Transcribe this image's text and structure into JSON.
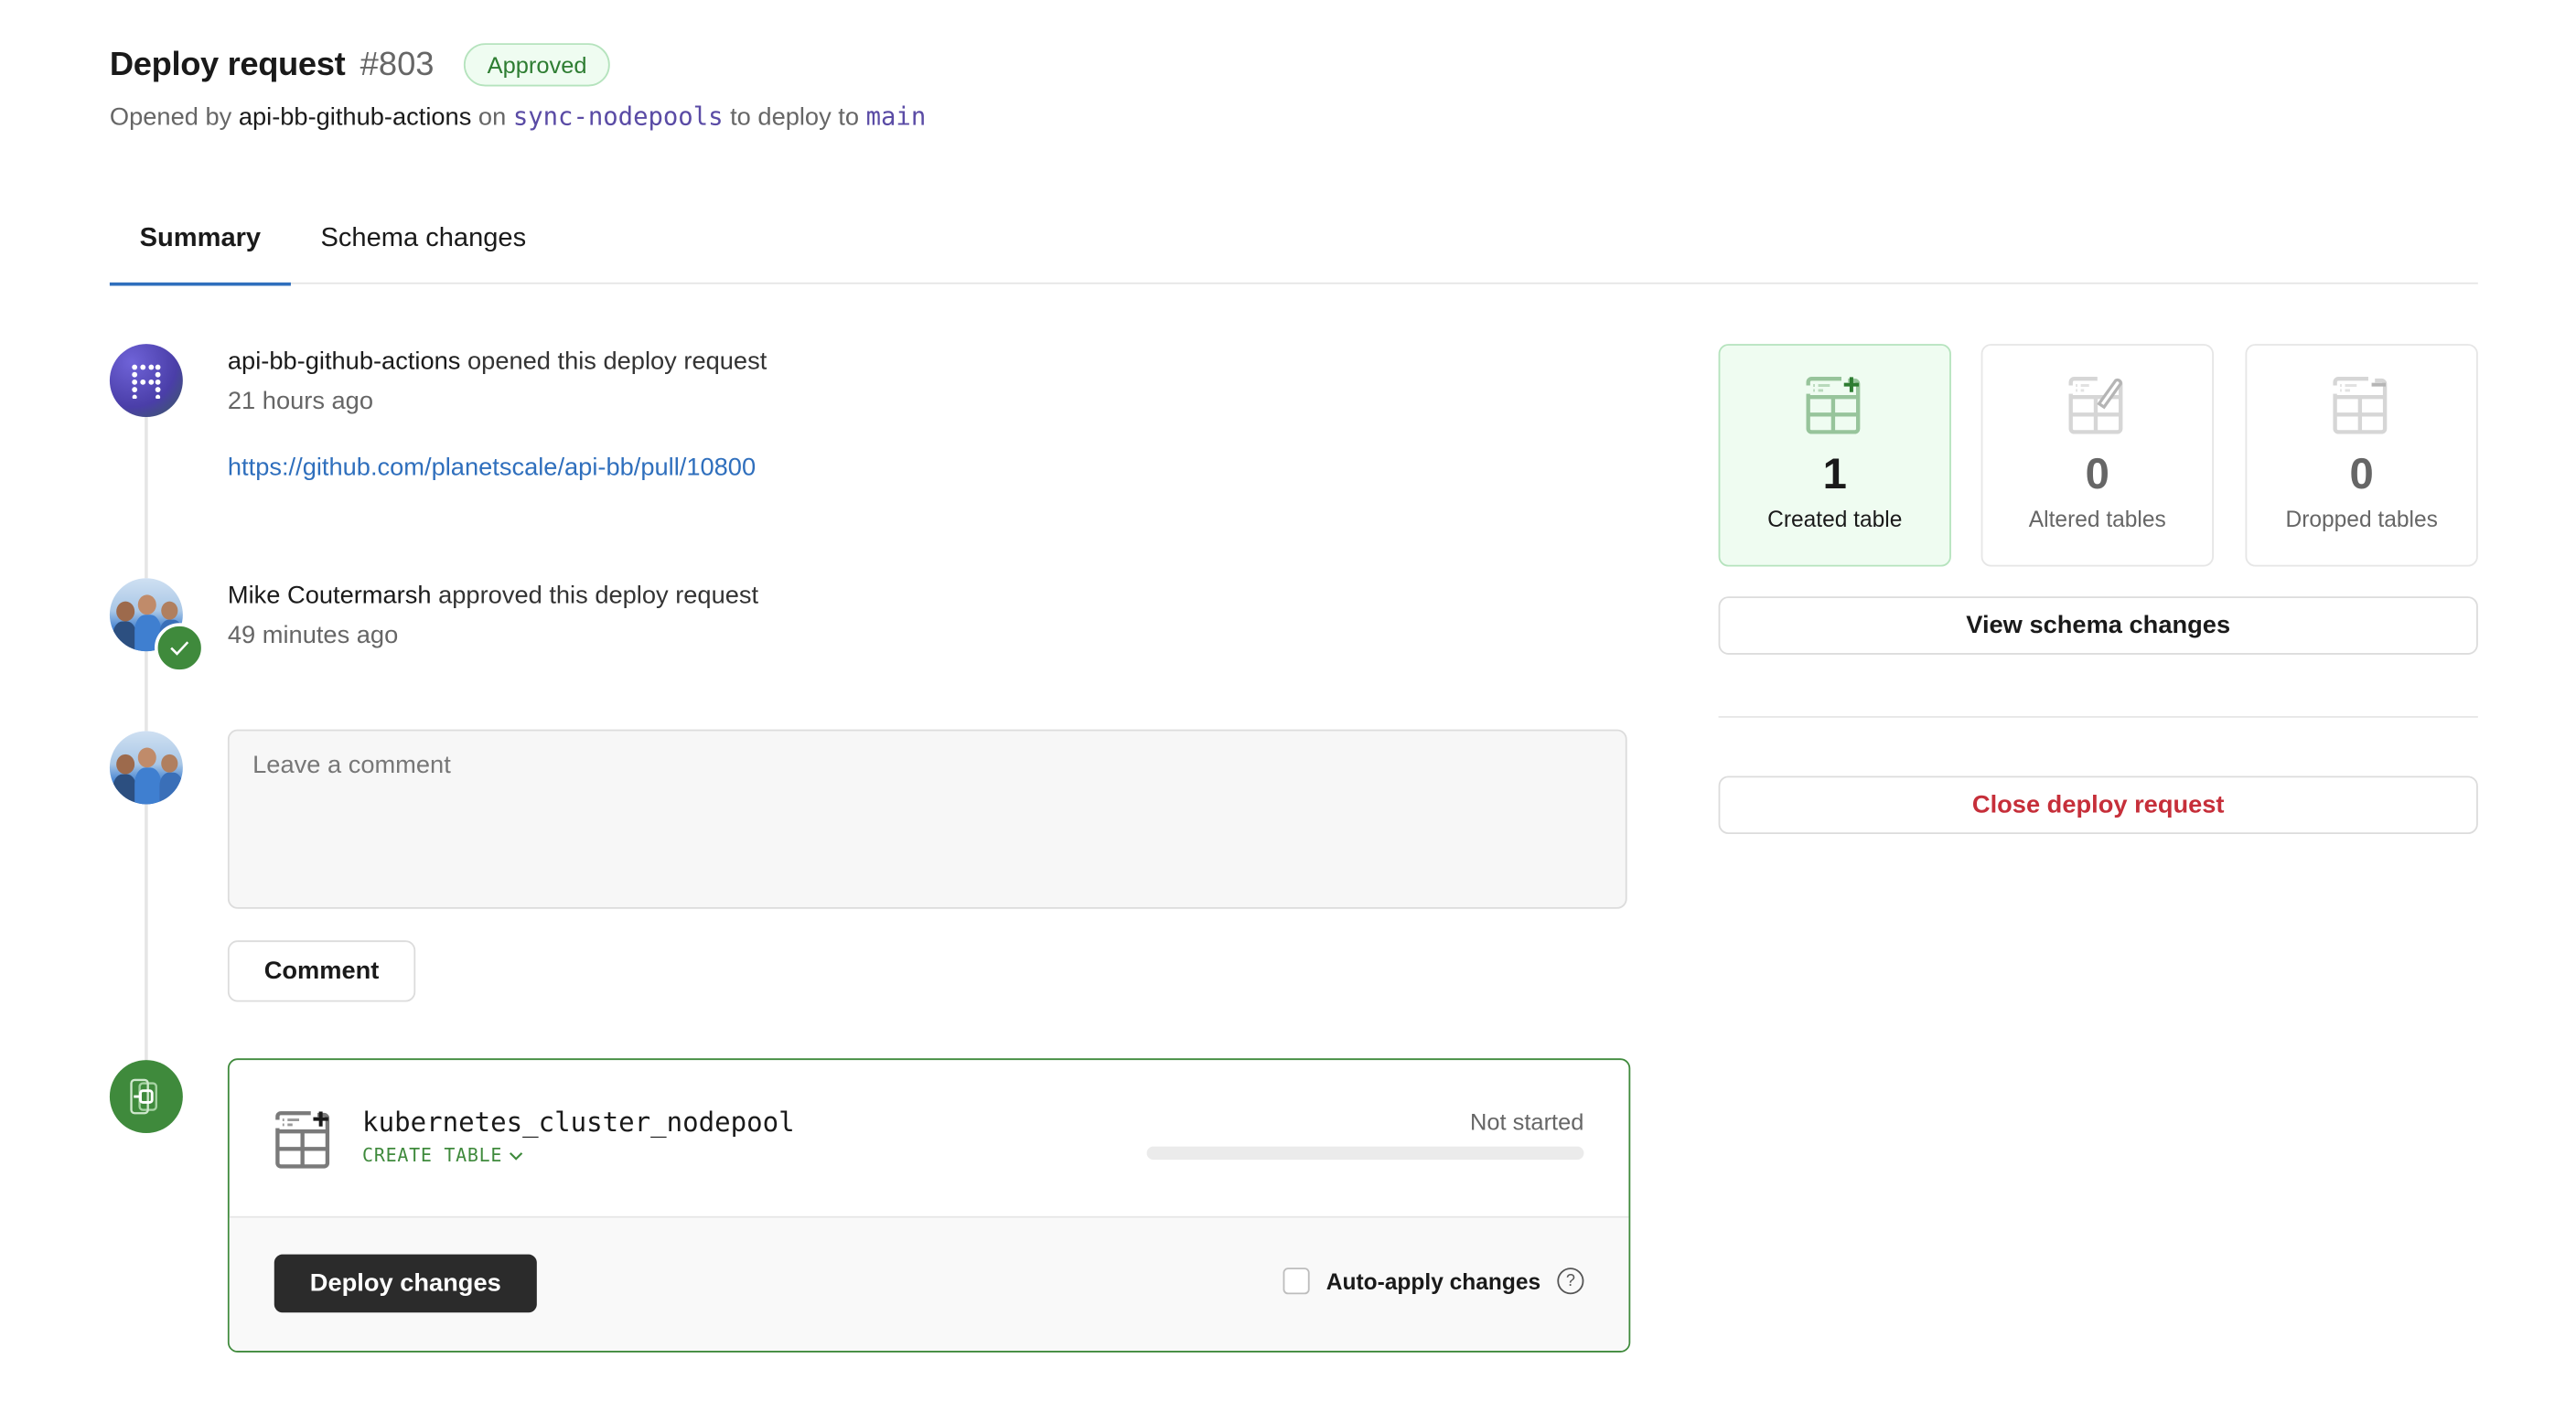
{
  "header": {
    "title": "Deploy request",
    "number": "#803",
    "status_badge": "Approved",
    "opened_by_prefix": "Opened by",
    "opened_by": "api-bb-github-actions",
    "on_label": "on",
    "source_branch": "sync-nodepools",
    "deploy_to_label": "to deploy to",
    "target_branch": "main"
  },
  "tabs": [
    {
      "label": "Summary",
      "active": true
    },
    {
      "label": "Schema changes",
      "active": false
    }
  ],
  "timeline": {
    "events": [
      {
        "actor": "api-bb-github-actions",
        "action": "opened this deploy request",
        "time": "21 hours ago",
        "avatar_icon": "planetscale-bot-avatar",
        "link": "https://github.com/planetscale/api-bb/pull/10800"
      },
      {
        "actor": "Mike Coutermarsh",
        "action": "approved this deploy request",
        "time": "49 minutes ago",
        "avatar_icon": "user-photo-avatar",
        "badge_icon": "check-icon"
      }
    ],
    "comment": {
      "placeholder": "Leave a comment",
      "value": "",
      "submit_label": "Comment"
    },
    "deploy": {
      "node_icon": "deploy-branch-icon",
      "table_name": "kubernetes_cluster_nodepool",
      "operation": "CREATE TABLE",
      "status": "Not started",
      "progress_percent": 0,
      "deploy_label": "Deploy changes",
      "auto_apply_label": "Auto-apply changes",
      "auto_apply_checked": false,
      "help_glyph": "?"
    }
  },
  "sidebar": {
    "stats": [
      {
        "value": "1",
        "label": "Created table",
        "icon": "table-plus-icon"
      },
      {
        "value": "0",
        "label": "Altered tables",
        "icon": "table-edit-icon"
      },
      {
        "value": "0",
        "label": "Dropped tables",
        "icon": "table-minus-icon"
      }
    ],
    "view_schema_label": "View schema changes",
    "close_label": "Close deploy request"
  },
  "colors": {
    "accent_blue": "#2f6fbd",
    "success_green": "#3f8a3c",
    "danger_red": "#c62f3a",
    "branch_purple": "#5a4ba5"
  }
}
